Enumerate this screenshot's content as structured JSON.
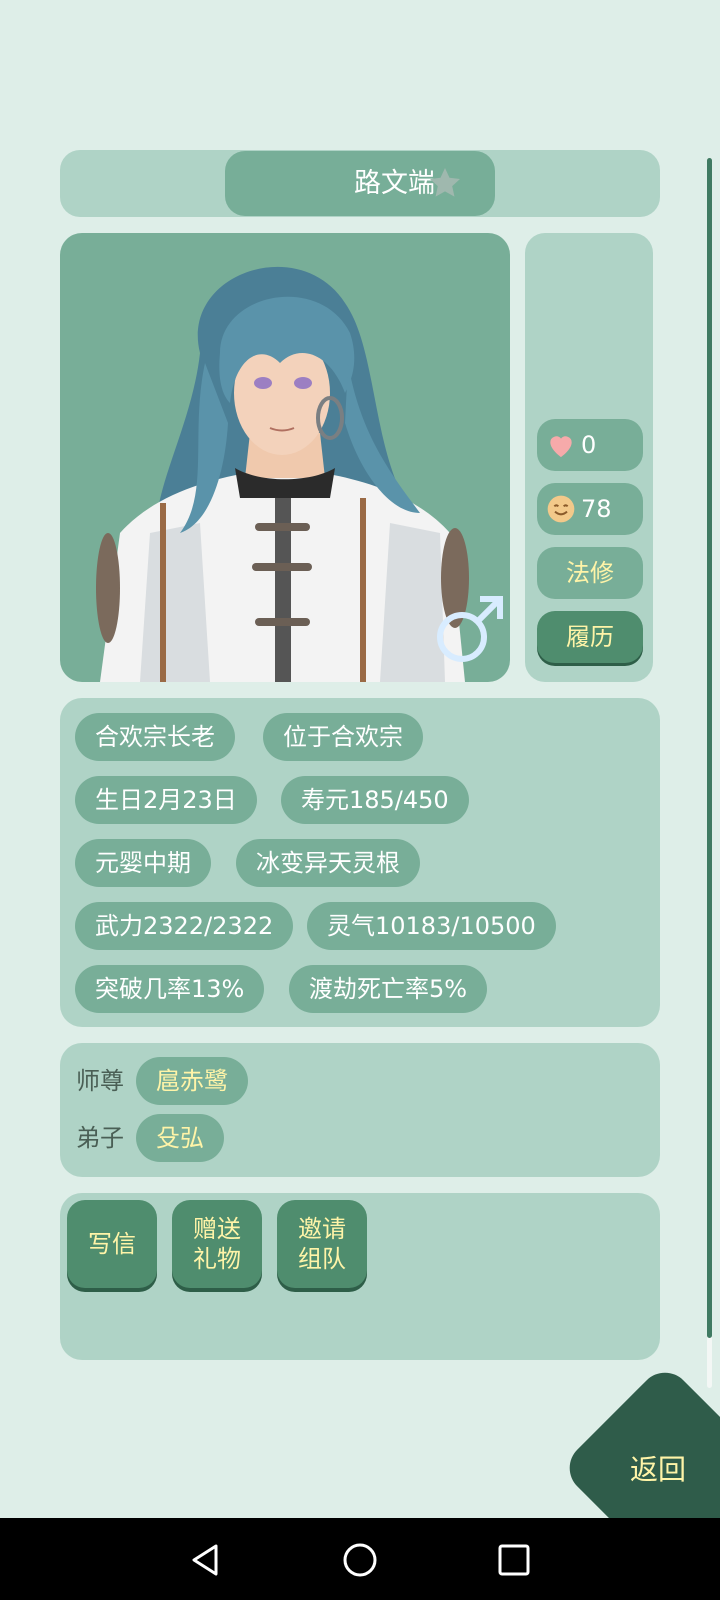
{
  "character": {
    "name": "路文端",
    "favorite_icon": "star-icon",
    "gender_icon": "male-icon"
  },
  "side_stats": {
    "affection": {
      "icon": "heart-icon",
      "value": "0"
    },
    "mood": {
      "icon": "smile-face-icon",
      "value": "78"
    },
    "class_label": "法修",
    "history_button": "履历"
  },
  "attributes": [
    "合欢宗长老",
    "位于合欢宗",
    "生日2月23日",
    "寿元185/450",
    "元婴中期",
    "冰变异天灵根",
    "武力2322/2322",
    "灵气10183/10500",
    "突破几率13%",
    "渡劫死亡率5%"
  ],
  "relations": {
    "master_label": "师尊",
    "master_name": "扈赤鹭",
    "disciple_label": "弟子",
    "disciple_name": "殳弘"
  },
  "actions": {
    "write_letter": "写信",
    "give_gift_line1": "赠送",
    "give_gift_line2": "礼物",
    "invite_team_line1": "邀请",
    "invite_team_line2": "组队"
  },
  "back_button": "返回",
  "colors": {
    "background": "#deeee8",
    "panel": "#afd3c6",
    "tag": "#78ae98",
    "button_dark": "#4f8d6e",
    "accent_text": "#fff4a8",
    "back_button": "#2f5c4a"
  }
}
